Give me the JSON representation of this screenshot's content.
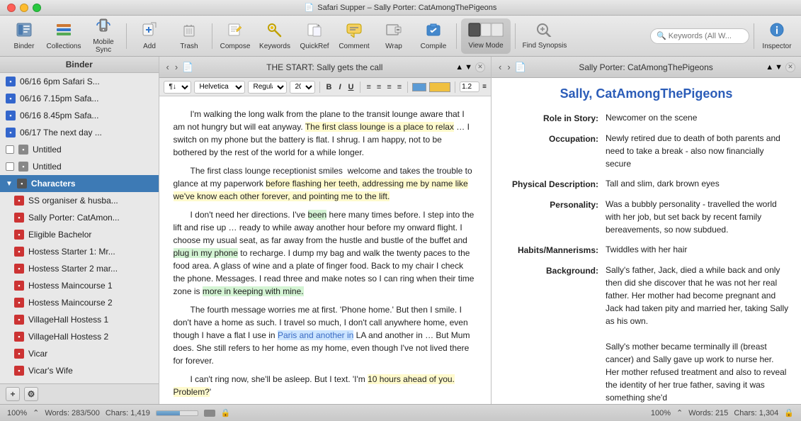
{
  "window": {
    "title": "Safari Supper – Sally Porter: CatAmongThePigeons",
    "doc_icon": "📄"
  },
  "toolbar": {
    "buttons": [
      {
        "id": "binder",
        "label": "Binder",
        "icon": "📂",
        "active": false
      },
      {
        "id": "collections",
        "label": "Collections",
        "icon": "🗂",
        "active": false
      },
      {
        "id": "mobile_sync",
        "label": "Mobile Sync",
        "icon": "📱",
        "active": false
      },
      {
        "id": "add",
        "label": "Add",
        "icon": "➕",
        "active": false
      },
      {
        "id": "trash",
        "label": "Trash",
        "icon": "🗑",
        "active": false
      },
      {
        "id": "compose",
        "label": "Compose",
        "icon": "✏️",
        "active": false
      },
      {
        "id": "keywords",
        "label": "Keywords",
        "icon": "🔑",
        "active": false
      },
      {
        "id": "quickref",
        "label": "QuickRef",
        "icon": "↗",
        "active": false
      },
      {
        "id": "comment",
        "label": "Comment",
        "icon": "💬",
        "active": false
      },
      {
        "id": "wrap",
        "label": "Wrap",
        "icon": "↩",
        "active": false
      },
      {
        "id": "compile",
        "label": "Compile",
        "icon": "⬆",
        "active": false
      },
      {
        "id": "view_mode",
        "label": "View Mode",
        "icon": "▦",
        "active": true
      },
      {
        "id": "find_synopsis",
        "label": "Find Synopsis",
        "icon": "🔍",
        "active": false
      },
      {
        "id": "search",
        "label": "Search",
        "icon": "🔍",
        "active": false
      },
      {
        "id": "inspector",
        "label": "Inspector",
        "icon": "ℹ",
        "active": false
      }
    ],
    "search_placeholder": "Keywords (All W..."
  },
  "sidebar": {
    "header": "Binder",
    "items": [
      {
        "id": "item1",
        "label": "06/16 6pm Safari S...",
        "icon_type": "blue",
        "checkbox": null,
        "indent": 0
      },
      {
        "id": "item2",
        "label": "06/16 7.15pm Safa...",
        "icon_type": "blue",
        "checkbox": null,
        "indent": 0
      },
      {
        "id": "item3",
        "label": "06/16 8.45pm Safa...",
        "icon_type": "blue",
        "checkbox": null,
        "indent": 0
      },
      {
        "id": "item4",
        "label": "06/17 The next day ...",
        "icon_type": "blue",
        "checkbox": null,
        "indent": 0
      },
      {
        "id": "item5",
        "label": "Untitled",
        "icon_type": "gray",
        "checkbox": true,
        "indent": 0
      },
      {
        "id": "item6",
        "label": "Untitled",
        "icon_type": "gray",
        "checkbox": true,
        "indent": 0
      },
      {
        "id": "group_chars",
        "label": "Characters",
        "icon_type": "group",
        "checkbox": null,
        "indent": 0,
        "is_group": true
      },
      {
        "id": "char1",
        "label": "SS organiser & husba...",
        "icon_type": "red",
        "checkbox": null,
        "indent": 1
      },
      {
        "id": "char2",
        "label": "Sally Porter: CatAmon...",
        "icon_type": "red",
        "checkbox": null,
        "indent": 1
      },
      {
        "id": "char3",
        "label": "Eligible Bachelor",
        "icon_type": "red",
        "checkbox": null,
        "indent": 1
      },
      {
        "id": "char4",
        "label": "Hostess Starter 1: Mr...",
        "icon_type": "red",
        "checkbox": null,
        "indent": 1
      },
      {
        "id": "char5",
        "label": "Hostess Starter 2 mar...",
        "icon_type": "red",
        "checkbox": null,
        "indent": 1
      },
      {
        "id": "char6",
        "label": "Hostess Maincourse 1",
        "icon_type": "red",
        "checkbox": null,
        "indent": 1
      },
      {
        "id": "char7",
        "label": "Hostess Maincourse 2",
        "icon_type": "red",
        "checkbox": null,
        "indent": 1
      },
      {
        "id": "char8",
        "label": "VillageHall Hostess 1",
        "icon_type": "red",
        "checkbox": null,
        "indent": 1
      },
      {
        "id": "char9",
        "label": "VillageHall Hostess 2",
        "icon_type": "red",
        "checkbox": null,
        "indent": 1
      },
      {
        "id": "char10",
        "label": "Vicar",
        "icon_type": "red",
        "checkbox": null,
        "indent": 1
      },
      {
        "id": "char11",
        "label": "Vicar's Wife",
        "icon_type": "red",
        "checkbox": null,
        "indent": 1
      }
    ],
    "footer_add": "+",
    "footer_settings": "⚙"
  },
  "left_editor": {
    "panel_title": "THE START: Sally gets the call",
    "format_bar": {
      "paragraph_style": "¶↓",
      "font": "Helvetica",
      "weight": "Regular",
      "size": "20",
      "bold": "B",
      "italic": "I",
      "underline": "U",
      "line_spacing": "1.2"
    },
    "content": [
      "I'm walking the long walk from the plane to the transit lounge aware that I am not hungry but will eat anyway. The first class lounge is a place to relax … I switch on my phone but the battery is flat. I shrug. I am happy, not to be bothered by the rest of the world for a while longer.",
      "The first class lounge receptionist smiles  welcome and takes the trouble to glance at my paperwork before flashing her teeth, addressing me by name like we've know each other forever, and pointing me to the lift.",
      "I don't need her directions. I've been here many times before. I step into the lift and rise up … ready to while away another hour before my onward flight. I choose my usual seat, as far away from the hustle and bustle of the buffet and plug in my phone to recharge. I dump my bag and walk the twenty paces to the food area. A glass of wine and a plate of finger food. Back to my chair I check the phone. Messages. I read three and make notes so I can ring when their time zone is more in keeping with mine.",
      "The fourth message worries me at first. 'Phone home.' But then I smile. I don't have a home as such. I travel so much, I don't call anywhere home, even though I have a flat I use in Paris and another in LA and another in … But Mum does. She still refers to her home as my home, even though I've not lived there for forever.",
      "I can't ring now, she'll be asleep. But I text. 'I'm 10 hours ahead of you. Problem?'"
    ],
    "status": {
      "zoom": "100%",
      "words_label": "Words: 283/500",
      "chars_label": "Chars: 1,419",
      "progress": 57
    }
  },
  "right_editor": {
    "panel_title": "Sally Porter: CatAmongThePigeons",
    "character": {
      "name": "Sally, CatAmongThePigeons",
      "fields": [
        {
          "label": "Role in Story:",
          "value": "Newcomer on the scene"
        },
        {
          "label": "Occupation:",
          "value": "Newly retired due to death of both parents and need to take a break - also now financially secure"
        },
        {
          "label": "Physical Description:",
          "value": "Tall and slim, dark brown eyes"
        },
        {
          "label": "Personality:",
          "value": "Was a bubbly personality - travelled the world with her job, but set back by recent family bereavements, so now subdued."
        },
        {
          "label": "Habits/Mannerisms:",
          "value": "Twiddles with her hair"
        },
        {
          "label": "Background:",
          "value": "Sally's father, Jack, died a while back and only then did she discover that he was not her real father. Her mother had become pregnant and Jack had taken pity and married her, taking Sally as his own.\n\nSally's mother became terminally ill (breast cancer) and Sally gave up work to nurse her.  Her mother refused treatment and also to reveal the identity of her true father, saving it was something she'd"
        }
      ]
    },
    "status": {
      "zoom": "100%",
      "words_label": "Words: 215",
      "chars_label": "Chars: 1,304"
    }
  },
  "highlighted_text": {
    "paris_and_another": "Paris and another"
  }
}
